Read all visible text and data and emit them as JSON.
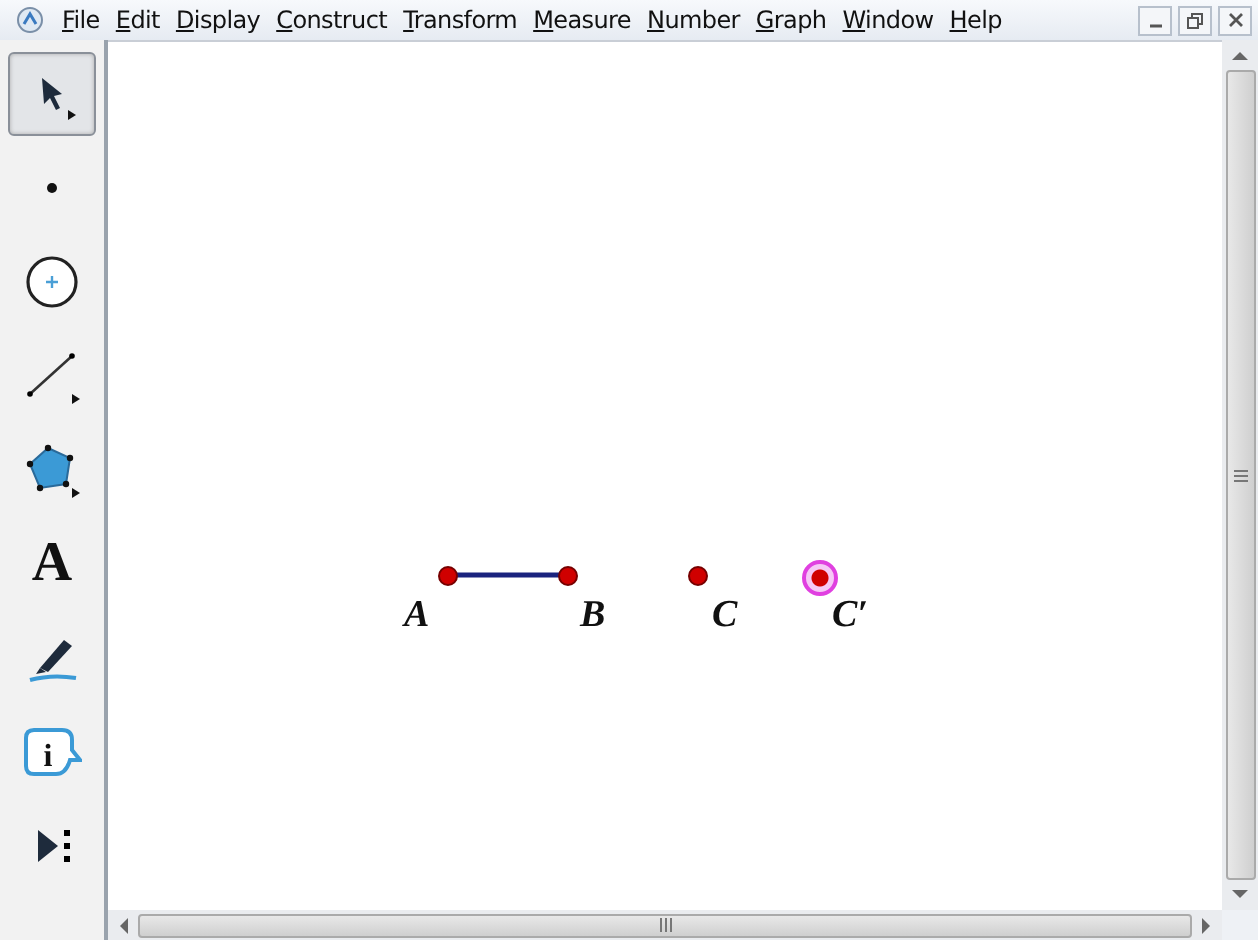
{
  "menu": [
    "File",
    "Edit",
    "Display",
    "Construct",
    "Transform",
    "Measure",
    "Number",
    "Graph",
    "Window",
    "Help"
  ],
  "tools": [
    {
      "kind": "arrow",
      "selected": true
    },
    {
      "kind": "point",
      "selected": false
    },
    {
      "kind": "compass",
      "selected": false
    },
    {
      "kind": "line",
      "selected": false
    },
    {
      "kind": "polygon",
      "selected": false
    },
    {
      "kind": "text",
      "glyph": "A",
      "selected": false
    },
    {
      "kind": "marker",
      "selected": false
    },
    {
      "kind": "info",
      "glyph": "i",
      "selected": false
    },
    {
      "kind": "custom",
      "selected": false
    }
  ],
  "points": [
    {
      "label": "A",
      "selected": false
    },
    {
      "label": "B",
      "selected": false
    },
    {
      "label": "C",
      "selected": false
    },
    {
      "label": "C′",
      "selected": true
    }
  ]
}
